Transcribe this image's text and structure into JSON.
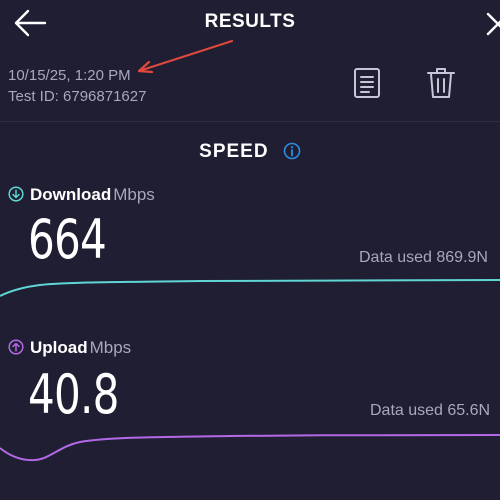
{
  "header": {
    "title": "RESULTS",
    "back_icon": "arrow-left-icon",
    "close_icon": "close-icon"
  },
  "test": {
    "date": "10/15/25, 1:20 PM",
    "id_text": "Test ID: 6796871627",
    "doc_icon": "document-icon",
    "delete_icon": "trash-icon"
  },
  "speed_section": {
    "heading": "SPEED",
    "info_icon": "info-icon"
  },
  "download": {
    "label": "Download",
    "unit": "Mbps",
    "value": "664",
    "data_used": "Data used 869.9N",
    "color": "#5fd6d3",
    "icon": "arrow-down-circle-icon"
  },
  "upload": {
    "label": "Upload",
    "unit": "Mbps",
    "value": "40.8",
    "data_used": "Data used 65.6N",
    "color": "#b369e6",
    "icon": "arrow-up-circle-icon"
  },
  "annotation": {
    "color": "#e0483c",
    "icon": "red-arrow-icon"
  },
  "colors": {
    "background": "#1f1e33",
    "muted_text": "#a9a7bd",
    "info_blue": "#2d8de0"
  }
}
